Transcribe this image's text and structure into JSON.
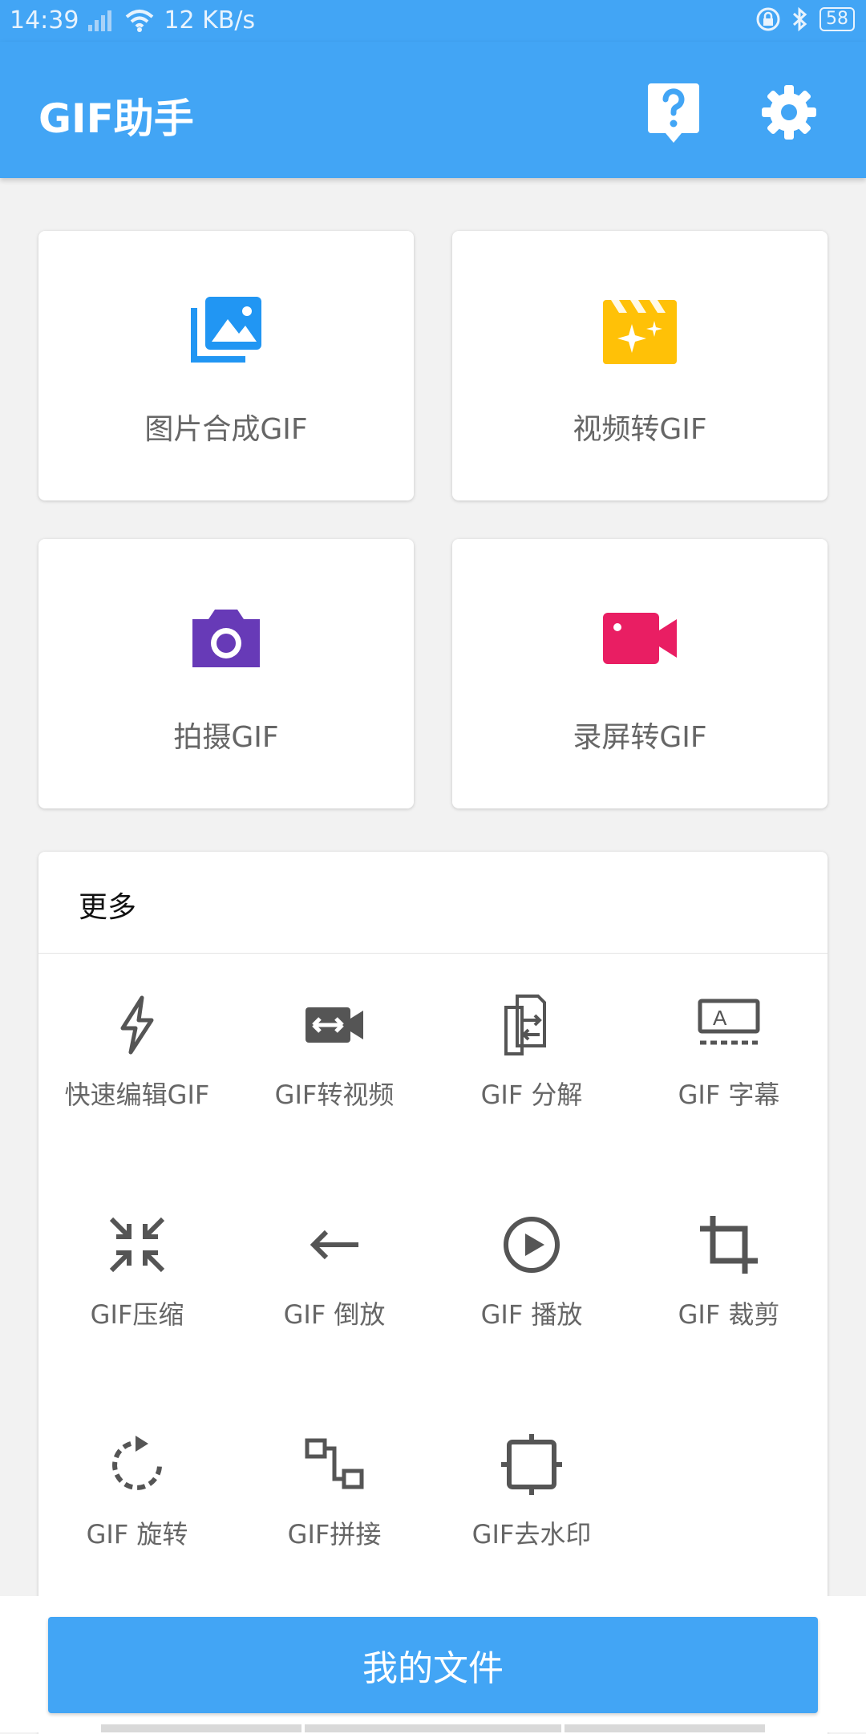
{
  "status": {
    "time": "14:39",
    "speed": "12 KB/s",
    "battery": "58"
  },
  "app": {
    "title": "GIF助手"
  },
  "cards": [
    {
      "label": "图片合成GIF",
      "icon": "image-collection-icon"
    },
    {
      "label": "视频转GIF",
      "icon": "video-sparkle-icon"
    },
    {
      "label": "拍摄GIF",
      "icon": "camera-icon"
    },
    {
      "label": "录屏转GIF",
      "icon": "video-camera-icon"
    }
  ],
  "more": {
    "title": "更多",
    "tools": [
      "快速编辑GIF",
      "GIF转视频",
      "GIF 分解",
      "GIF 字幕",
      "GIF压缩",
      "GIF 倒放",
      "GIF 播放",
      "GIF 裁剪",
      "GIF 旋转",
      "GIF拼接",
      "GIF去水印"
    ]
  },
  "bottom": {
    "my_files": "我的文件"
  },
  "colors": {
    "primary": "#42a5f5",
    "image": "#2196f3",
    "video": "#ffc107",
    "camera": "#673ab7",
    "record": "#e91e63",
    "tool": "#555555"
  }
}
